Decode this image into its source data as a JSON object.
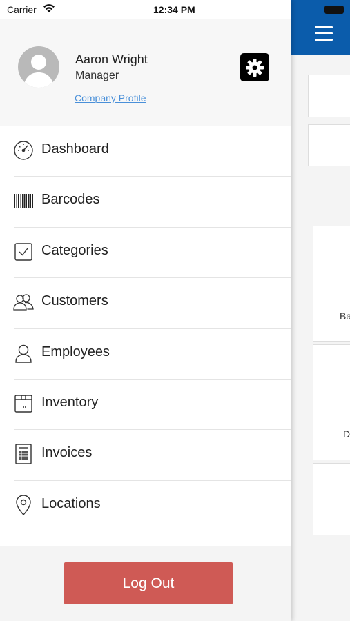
{
  "status_bar": {
    "carrier": "Carrier",
    "time": "12:34 PM"
  },
  "profile": {
    "name": "Aaron Wright",
    "role": "Manager",
    "company_link": "Company Profile"
  },
  "menu": {
    "items": [
      {
        "label": "Dashboard",
        "icon": "speedometer-icon"
      },
      {
        "label": "Barcodes",
        "icon": "barcode-icon"
      },
      {
        "label": "Categories",
        "icon": "checkbox-icon"
      },
      {
        "label": "Customers",
        "icon": "users-icon"
      },
      {
        "label": "Employees",
        "icon": "user-icon"
      },
      {
        "label": "Inventory",
        "icon": "box-icon"
      },
      {
        "label": "Invoices",
        "icon": "invoice-icon"
      },
      {
        "label": "Locations",
        "icon": "location-pin-icon"
      }
    ]
  },
  "footer": {
    "logout_label": "Log Out"
  },
  "background": {
    "labels": [
      "Ba",
      "D"
    ]
  },
  "colors": {
    "header_blue": "#0b5cab",
    "logout_red": "#cf5a55",
    "link_blue": "#4a90d9"
  }
}
